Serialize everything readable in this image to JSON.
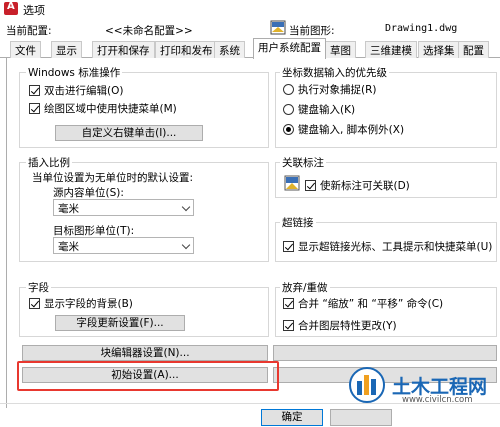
{
  "window": {
    "title": "选项"
  },
  "header": {
    "current_profile_label": "当前配置:",
    "current_profile_value": "<<未命名配置>>",
    "current_drawing_label": "当前图形:",
    "current_drawing_value": "Drawing1.dwg"
  },
  "tabs": [
    {
      "label": "文件"
    },
    {
      "label": "显示"
    },
    {
      "label": "打开和保存"
    },
    {
      "label": "打印和发布"
    },
    {
      "label": "系统"
    },
    {
      "label": "用户系统配置",
      "active": true
    },
    {
      "label": "草图"
    },
    {
      "label": "三维建模"
    },
    {
      "label": "选择集"
    },
    {
      "label": "配置"
    }
  ],
  "windows_ops": {
    "title": "Windows 标准操作",
    "double_click_edit": {
      "label": "双击进行编辑(O)",
      "checked": true
    },
    "shortcut_menu": {
      "label": "绘图区域中使用快捷菜单(M)",
      "checked": true
    },
    "custom_right_click_button": "自定义右键单击(I)..."
  },
  "coord_priority": {
    "title": "坐标数据输入的优先级",
    "options": [
      {
        "label": "执行对象捕捉(R)",
        "selected": false
      },
      {
        "label": "键盘输入(K)",
        "selected": false
      },
      {
        "label": "键盘输入, 脚本例外(X)",
        "selected": true
      }
    ]
  },
  "insert_scale": {
    "title": "插入比例",
    "desc": "当单位设置为无单位时的默认设置:",
    "source_label": "源内容单位(S):",
    "source_value": "毫米",
    "target_label": "目标图形单位(T):",
    "target_value": "毫米"
  },
  "associative_dim": {
    "title": "关联标注",
    "new_dims_associative": {
      "label": "使新标注可关联(D)",
      "checked": true
    }
  },
  "hyperlink": {
    "title": "超链接",
    "show_cursor": {
      "label": "显示超链接光标、工具提示和快捷菜单(U)",
      "checked": true
    }
  },
  "fields": {
    "title": "字段",
    "show_background": {
      "label": "显示字段的背景(B)",
      "checked": true
    },
    "update_settings_button": "字段更新设置(F)..."
  },
  "undo_redo": {
    "title": "放弃/重做",
    "combine_zoom_pan": {
      "label": "合并 “缩放” 和 “平移” 命令(C)",
      "checked": true
    },
    "combine_layer": {
      "label": "合并图层特性更改(Y)",
      "checked": true
    }
  },
  "buttons": {
    "block_editor": "块编辑器设置(N)...",
    "initial_setup": "初始设置(A)...",
    "ok": "确定"
  },
  "watermark": {
    "brand": "土木工程网",
    "url": "www.civilcn.com"
  },
  "colors": {
    "highlight_box": "#e8382f",
    "watermark_blue": "#1a67b5"
  }
}
